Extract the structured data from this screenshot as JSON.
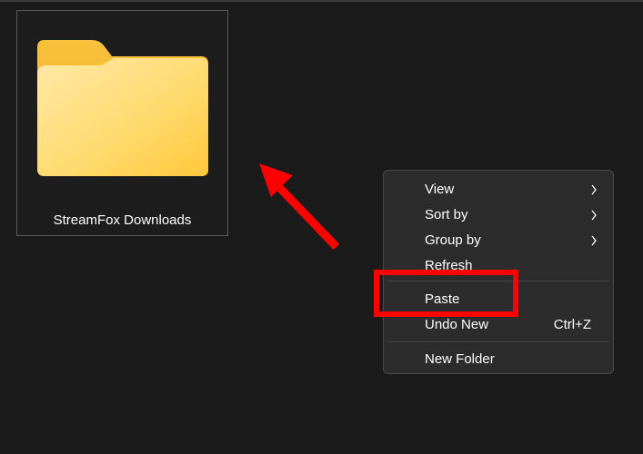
{
  "folder": {
    "name": "StreamFox Downloads",
    "icon": "folder-icon"
  },
  "context_menu": {
    "items": [
      {
        "label": "View",
        "has_submenu": true
      },
      {
        "label": "Sort by",
        "has_submenu": true
      },
      {
        "label": "Group by",
        "has_submenu": true
      },
      {
        "label": "Refresh"
      },
      {
        "label": "Paste"
      },
      {
        "label": "Undo New",
        "shortcut": "Ctrl+Z"
      },
      {
        "label": "New Folder"
      }
    ]
  },
  "annotations": {
    "arrow_color": "#ff0000",
    "highlight_color": "#ff0000",
    "highlighted_item": "Paste"
  },
  "colors": {
    "background": "#1b1b1b",
    "menu_background": "#2c2c2c",
    "folder_front": "#ffd65c",
    "folder_back": "#f5b82e"
  }
}
